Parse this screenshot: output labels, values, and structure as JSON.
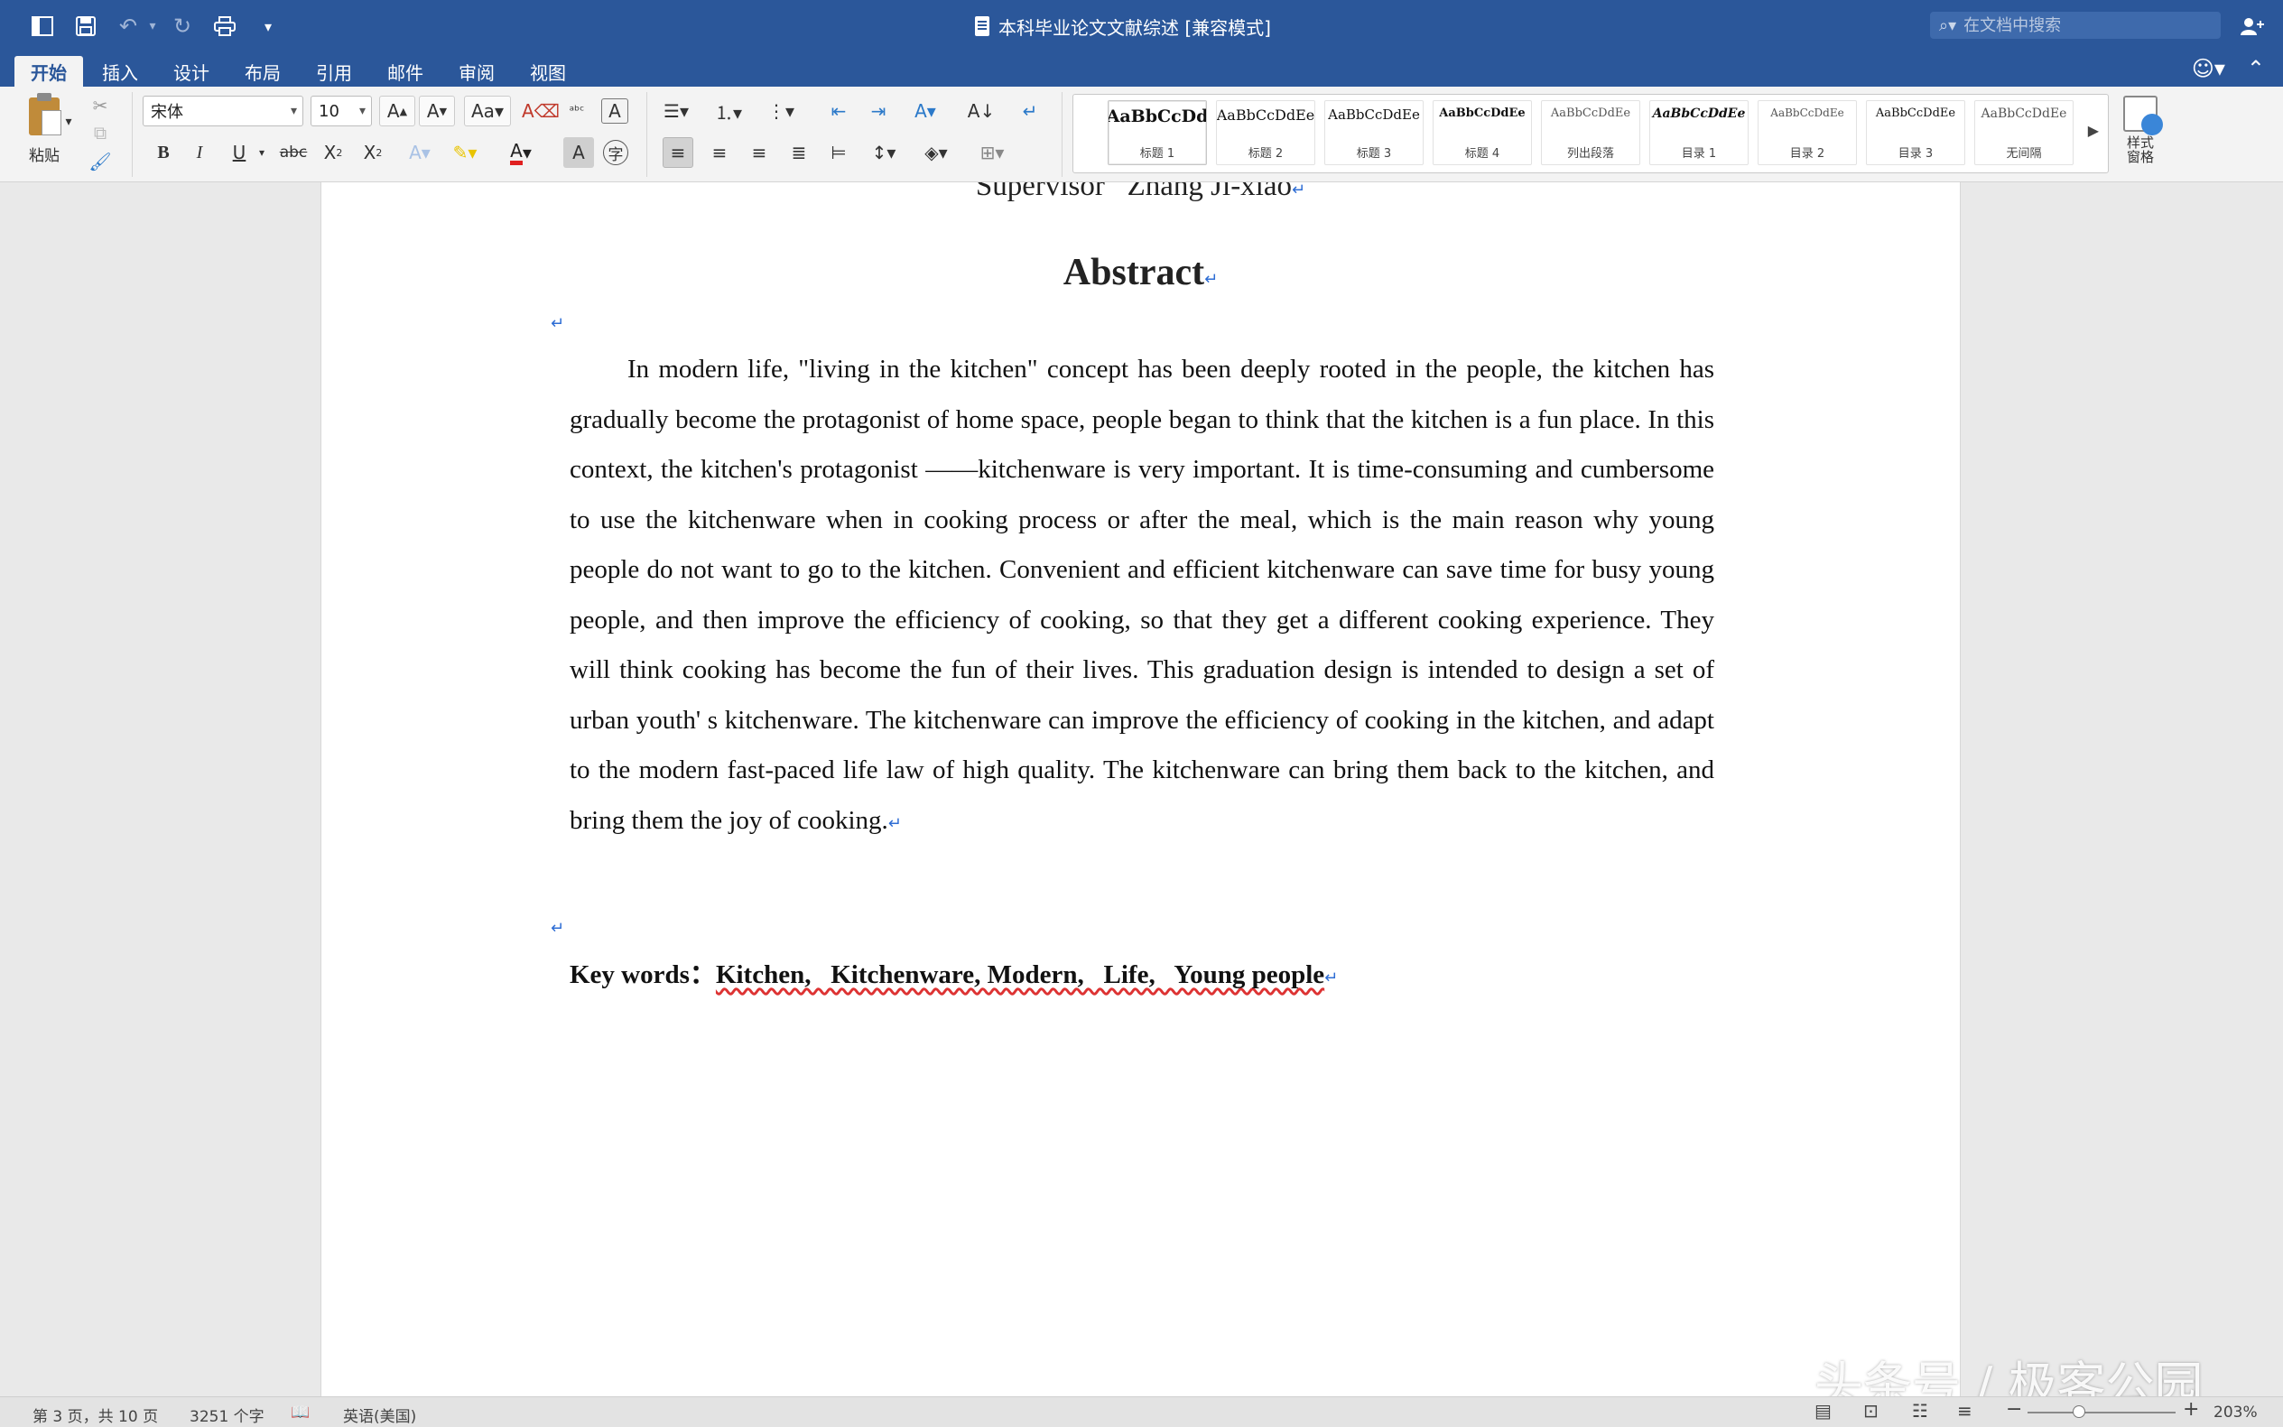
{
  "window": {
    "title": "本科毕业论文文献综述 [兼容模式]",
    "search_placeholder": "在文档中搜索"
  },
  "quick_access": [
    {
      "name": "sidebar-toggle-icon",
      "glyph": "◫"
    },
    {
      "name": "save-icon",
      "glyph": "🖫"
    },
    {
      "name": "undo-icon",
      "glyph": "↶"
    },
    {
      "name": "redo-icon",
      "glyph": "↻"
    },
    {
      "name": "print-icon",
      "glyph": "⎙"
    },
    {
      "name": "customize-icon",
      "glyph": "▾"
    }
  ],
  "tabs": [
    "开始",
    "插入",
    "设计",
    "布局",
    "引用",
    "邮件",
    "审阅",
    "视图"
  ],
  "active_tab": "开始",
  "ribbon": {
    "paste_label": "粘贴",
    "font_name": "宋体",
    "font_size": "10",
    "styles": [
      {
        "sample": "AaBbCcDd",
        "label": "标题 1"
      },
      {
        "sample": "AaBbCcDdEe",
        "label": "标题 2"
      },
      {
        "sample": "AaBbCcDdEe",
        "label": "标题 3"
      },
      {
        "sample": "AaBbCcDdEe",
        "label": "标题 4"
      },
      {
        "sample": "AaBbCcDdEe",
        "label": "列出段落"
      },
      {
        "sample": "AaBbCcDdEe",
        "label": "目录 1"
      },
      {
        "sample": "AaBbCcDdEe",
        "label": "目录 2"
      },
      {
        "sample": "AaBbCcDdEe",
        "label": "目录 3"
      },
      {
        "sample": "AaBbCcDdEe",
        "label": "无间隔"
      }
    ],
    "styles_pane_label": "样式\n窗格"
  },
  "document": {
    "supervisor_line": "Supervisor   Zhang Ji-xiao",
    "abstract_title": "Abstract",
    "abstract_body": "In modern life, \"living in the kitchen\" concept has been deeply rooted in the people, the kitchen has gradually become the protagonist of home space, people began to think that the kitchen is a fun place. In this context, the kitchen's protagonist ——kitchenware is very important. It is time-consuming and cumbersome to use the kitchenware when in cooking process or after the meal, which is the main reason why young people do not want to go to the kitchen. Convenient and efficient kitchenware can save time for busy young people, and then improve the efficiency of cooking, so that they get a different cooking experience. They will think cooking has become the fun of their lives. This graduation design is intended to design a set of urban youth' s kitchenware. The kitchenware can improve the efficiency of cooking in the kitchen, and adapt to the modern fast-paced life law of high quality. The kitchenware can bring them back to the kitchen, and bring them the joy of cooking.",
    "keywords_label": "Key words",
    "keywords_sep": "：",
    "keywords": "Kitchen,   Kitchenware, Modern,   Life,   Young people",
    "para_mark": "↵"
  },
  "status": {
    "page": "第 3 页，共 10 页",
    "words": "3251 个字",
    "language": "英语(美国)",
    "zoom": "203%",
    "zoom_fraction": 0.35
  },
  "watermark": "头条号 / 极客公园",
  "colors": {
    "title_bar": "#2b579a",
    "ribbon_bg": "#f3f3f3",
    "para_mark": "#2e6dd4",
    "spell_underline": "#dd3333"
  }
}
